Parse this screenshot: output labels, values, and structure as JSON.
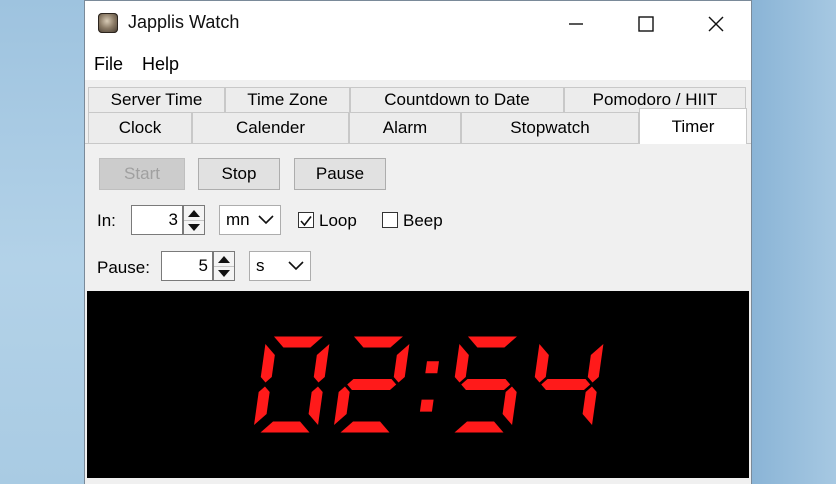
{
  "window": {
    "title": "Japplis Watch"
  },
  "menu": {
    "items": [
      "File",
      "Help"
    ]
  },
  "tabs": {
    "row1": [
      "Server Time",
      "Time Zone",
      "Countdown to Date",
      "Pomodoro / HIIT"
    ],
    "row2": [
      "Clock",
      "Calender",
      "Alarm",
      "Stopwatch",
      "Timer"
    ],
    "active": "Timer"
  },
  "controls": {
    "start_label": "Start",
    "stop_label": "Stop",
    "pause_label": "Pause",
    "in_label": "In:",
    "in_value": "3",
    "in_unit": "mn",
    "loop_label": "Loop",
    "loop_checked": true,
    "beep_label": "Beep",
    "beep_checked": false,
    "pause_field_label": "Pause:",
    "pause_value": "5",
    "pause_unit": "s"
  },
  "display": {
    "time": "02:54",
    "color": "#ff1a1a"
  },
  "colors": {
    "display_bg": "#000000",
    "window_bg": "#f0f0f0"
  }
}
